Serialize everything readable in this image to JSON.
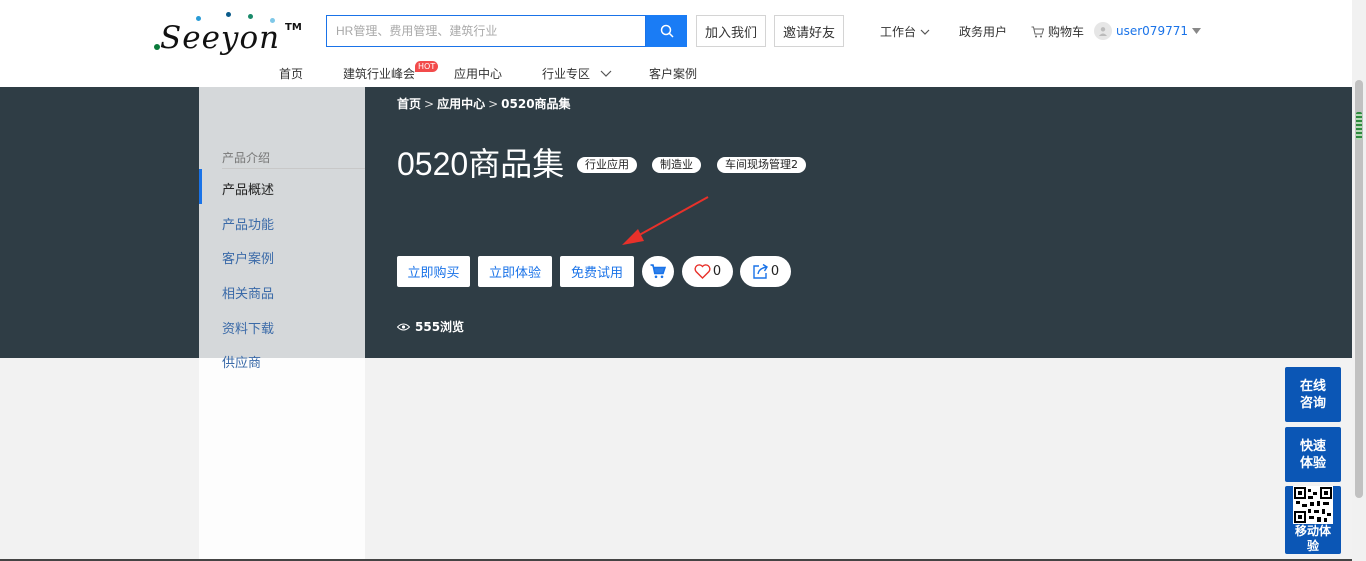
{
  "logo": {
    "text": "Seeyon",
    "tm": "TM"
  },
  "search": {
    "placeholder": "HR管理、费用管理、建筑行业"
  },
  "header": {
    "join_label": "加入我们",
    "invite_label": "邀请好友",
    "workbench_label": "工作台",
    "gov_label": "政务用户",
    "cart_label": "购物车",
    "username": "user079771"
  },
  "nav": {
    "items": [
      "首页",
      "建筑行业峰会",
      "应用中心",
      "行业专区",
      "客户案例"
    ],
    "hot_badge": "HOT"
  },
  "sidebar": {
    "heading": "产品介绍",
    "items": [
      "产品概述",
      "产品功能",
      "客户案例",
      "相关商品",
      "资料下载",
      "供应商"
    ]
  },
  "breadcrumb": {
    "items": [
      "首页",
      "应用中心",
      "0520商品集"
    ],
    "separator": ">"
  },
  "product": {
    "title": "0520商品集",
    "tags": [
      "行业应用",
      "制造业",
      "车间现场管理2"
    ],
    "buy_label": "立即购买",
    "experience_label": "立即体验",
    "trial_label": "免费试用",
    "like_count": "0",
    "share_count": "0",
    "views": "555浏览"
  },
  "float": {
    "consult_label": "在线咨询",
    "quick_label": "快速体验",
    "mobile_label": "移动体验"
  },
  "colors": {
    "accent": "#1a73e8",
    "banner": "#2f3d45",
    "float": "#0b56b5",
    "hot": "#f24b4b"
  }
}
